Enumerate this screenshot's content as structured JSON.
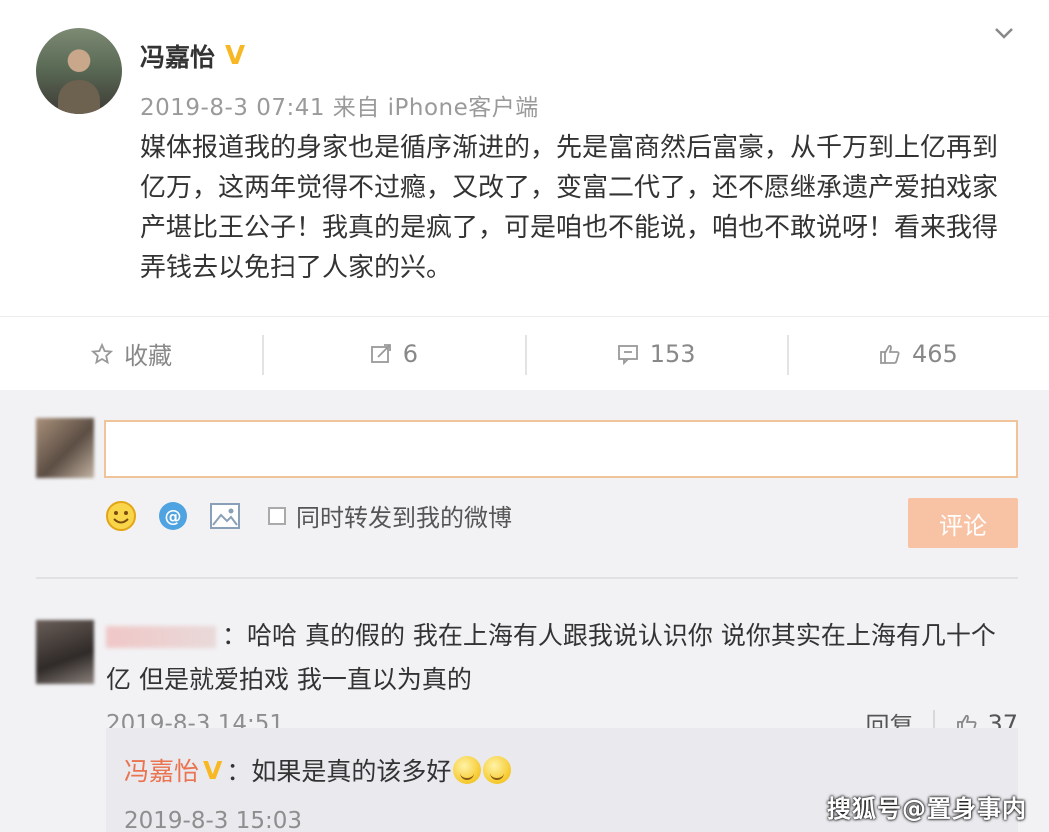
{
  "post": {
    "author": "冯嘉怡",
    "verified_badge": "V",
    "timestamp": "2019-8-3 07:41 来自 iPhone客户端",
    "content": "媒体报道我的身家也是循序渐进的，先是富商然后富豪，从千万到上亿再到亿万，这两年觉得不过瘾，又改了，变富二代了，还不愿继承遗产爱拍戏家产堪比王公子！我真的是疯了，可是咱也不能说，咱也不敢说呀！看来我得弄钱去以免扫了人家的兴。"
  },
  "actions": {
    "favorite": {
      "label": "收藏",
      "icon": "star-icon"
    },
    "repost": {
      "count": "6",
      "icon": "repost-icon"
    },
    "comment": {
      "count": "153",
      "icon": "comment-icon"
    },
    "like": {
      "count": "465",
      "icon": "thumbs-up-icon"
    }
  },
  "composer": {
    "placeholder": "",
    "forward_label": "同时转发到我的微博",
    "submit_label": "评论",
    "tools": [
      "emoji-icon",
      "mention-icon",
      "image-icon"
    ]
  },
  "comments": [
    {
      "text": "：哈哈 真的假的 我在上海有人跟我说认识你 说你其实在上海有几十个亿 但是就爱拍戏 我一直以为真的",
      "time": "2019-8-3 14:51",
      "reply_label": "回复",
      "like_count": "37",
      "reply": {
        "author": "冯嘉怡",
        "badge": "V",
        "text": "：如果是真的该多好",
        "time": "2019-8-3 15:03"
      }
    }
  ],
  "watermark": "搜狐号@置身事内",
  "colors": {
    "accent": "#eb7350",
    "verified": "#f7b824",
    "submit_bg": "#f8c3a5",
    "input_border": "#f0c49b"
  }
}
